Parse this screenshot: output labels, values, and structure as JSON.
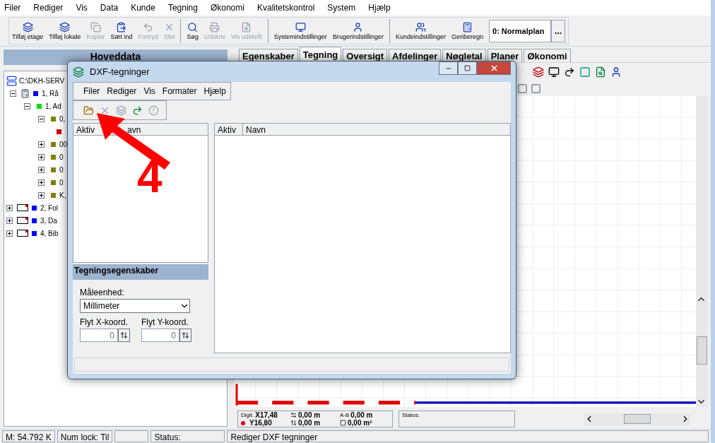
{
  "menu": [
    "Filer",
    "Rediger",
    "Vis",
    "Data",
    "Kunde",
    "Tegning",
    "Økonomi",
    "Kvalitetskontrol",
    "System",
    "Hjælp"
  ],
  "toolbar": [
    {
      "label": "Tilføj etage",
      "kind": "floor",
      "disabled": false,
      "separator": false
    },
    {
      "label": "Tilføj lokale",
      "kind": "room",
      "disabled": false,
      "separator": false
    },
    {
      "label": "Kopier",
      "kind": "copy",
      "disabled": true,
      "separator": false
    },
    {
      "label": "Sæt ind",
      "kind": "paste",
      "disabled": false,
      "separator": false
    },
    {
      "label": "Fortryd",
      "kind": "undo",
      "disabled": true,
      "separator": false
    },
    {
      "label": "Slet",
      "kind": "delete",
      "disabled": true,
      "separator": false
    },
    {
      "label": "Søg",
      "kind": "search",
      "disabled": false,
      "separator": true
    },
    {
      "label": "Udskriv",
      "kind": "print",
      "disabled": true,
      "separator": false
    },
    {
      "label": "Vis udskrift",
      "kind": "preview",
      "disabled": true,
      "separator": false
    },
    {
      "label": "Systemindstillinger",
      "kind": "system",
      "disabled": false,
      "separator": true
    },
    {
      "label": "Brugerindstillinger",
      "kind": "user",
      "disabled": false,
      "separator": false
    },
    {
      "label": "Kundeindstillinger",
      "kind": "customer",
      "disabled": false,
      "separator": true
    },
    {
      "label": "Genberegn",
      "kind": "calc",
      "disabled": false,
      "separator": false
    }
  ],
  "plan_select": {
    "value": "0: Normalplan",
    "button": "..."
  },
  "left_panel": {
    "title": "Hoveddata"
  },
  "tree": [
    {
      "label": "C:\\DKH-SERV",
      "kind": "server",
      "children": [
        {
          "label": "1, Rå",
          "kind": "calculator",
          "color": "#0000ff",
          "expanded": true,
          "children": [
            {
              "label": "1, Ad",
              "kind": "plain",
              "color": "#00e000",
              "expanded": true,
              "children": [
                {
                  "label": "0,",
                  "kind": "plain",
                  "color": "#808000",
                  "expanded": true,
                  "children": [
                    {
                      "kind": "leaf",
                      "color": "#d00000"
                    }
                  ]
                },
                {
                  "label": "00",
                  "kind": "plain",
                  "color": "#808000",
                  "expanded": false
                },
                {
                  "label": "0",
                  "kind": "plain",
                  "color": "#808000",
                  "expanded": false
                },
                {
                  "label": "0",
                  "kind": "plain",
                  "color": "#808000",
                  "expanded": false
                },
                {
                  "label": "0",
                  "kind": "plain",
                  "color": "#808000",
                  "expanded": false
                },
                {
                  "label": "K,",
                  "kind": "plain",
                  "color": "#808000",
                  "expanded": false
                }
              ]
            }
          ]
        }
      ]
    },
    {
      "label": "2, Fol",
      "kind": "card",
      "color": "#0000ff",
      "expanded": false
    },
    {
      "label": "3, Da",
      "kind": "card",
      "color": "#0000ff",
      "expanded": false
    },
    {
      "label": "4, Bib",
      "kind": "card",
      "color": "#0000ff",
      "expanded": false
    }
  ],
  "tabs": [
    {
      "label": "Egenskaber",
      "selected": false
    },
    {
      "label": "Tegning",
      "selected": true
    },
    {
      "label": "Oversigt",
      "selected": false
    },
    {
      "label": "Afdelinger",
      "selected": false
    },
    {
      "label": "Nøgletal",
      "selected": false
    },
    {
      "label": "Planer",
      "selected": false
    },
    {
      "label": "Økonomi",
      "selected": false
    }
  ],
  "info_bar": {
    "digit": "Digit.",
    "x": "X17,48",
    "y": "Y16,80",
    "width": "0,00 m",
    "height": "0,00 m",
    "ab_label": "A-B",
    "ab": "0,00 m",
    "area": "0,00 m²",
    "status": "Status:"
  },
  "status_bar": [
    "M: 54.792 K",
    "Num lock: Til",
    "Status:",
    "Rediger DXF tegninger"
  ],
  "dialog": {
    "title": "DXF-tegninger",
    "menu": [
      "Filer",
      "Rediger",
      "Vis",
      "Formater",
      "Hjælp"
    ],
    "tools": [
      {
        "kind": "open",
        "disabled": false
      },
      {
        "kind": "delete",
        "disabled": true
      },
      {
        "kind": "layer",
        "disabled": true
      },
      {
        "kind": "redo",
        "disabled": false
      },
      {
        "kind": "alert",
        "disabled": true
      }
    ],
    "left_columns": [
      "Aktiv",
      "avn"
    ],
    "right_columns": [
      "Aktiv",
      "Navn"
    ],
    "properties_title": "Tegningsegenskaber",
    "unit_label": "Måleenhed:",
    "unit_value": "Millimeter",
    "x_label": "Flyt X-koord.",
    "x_value": "0",
    "y_label": "Flyt Y-koord.",
    "y_value": "0"
  },
  "annotation": {
    "text": "4"
  }
}
